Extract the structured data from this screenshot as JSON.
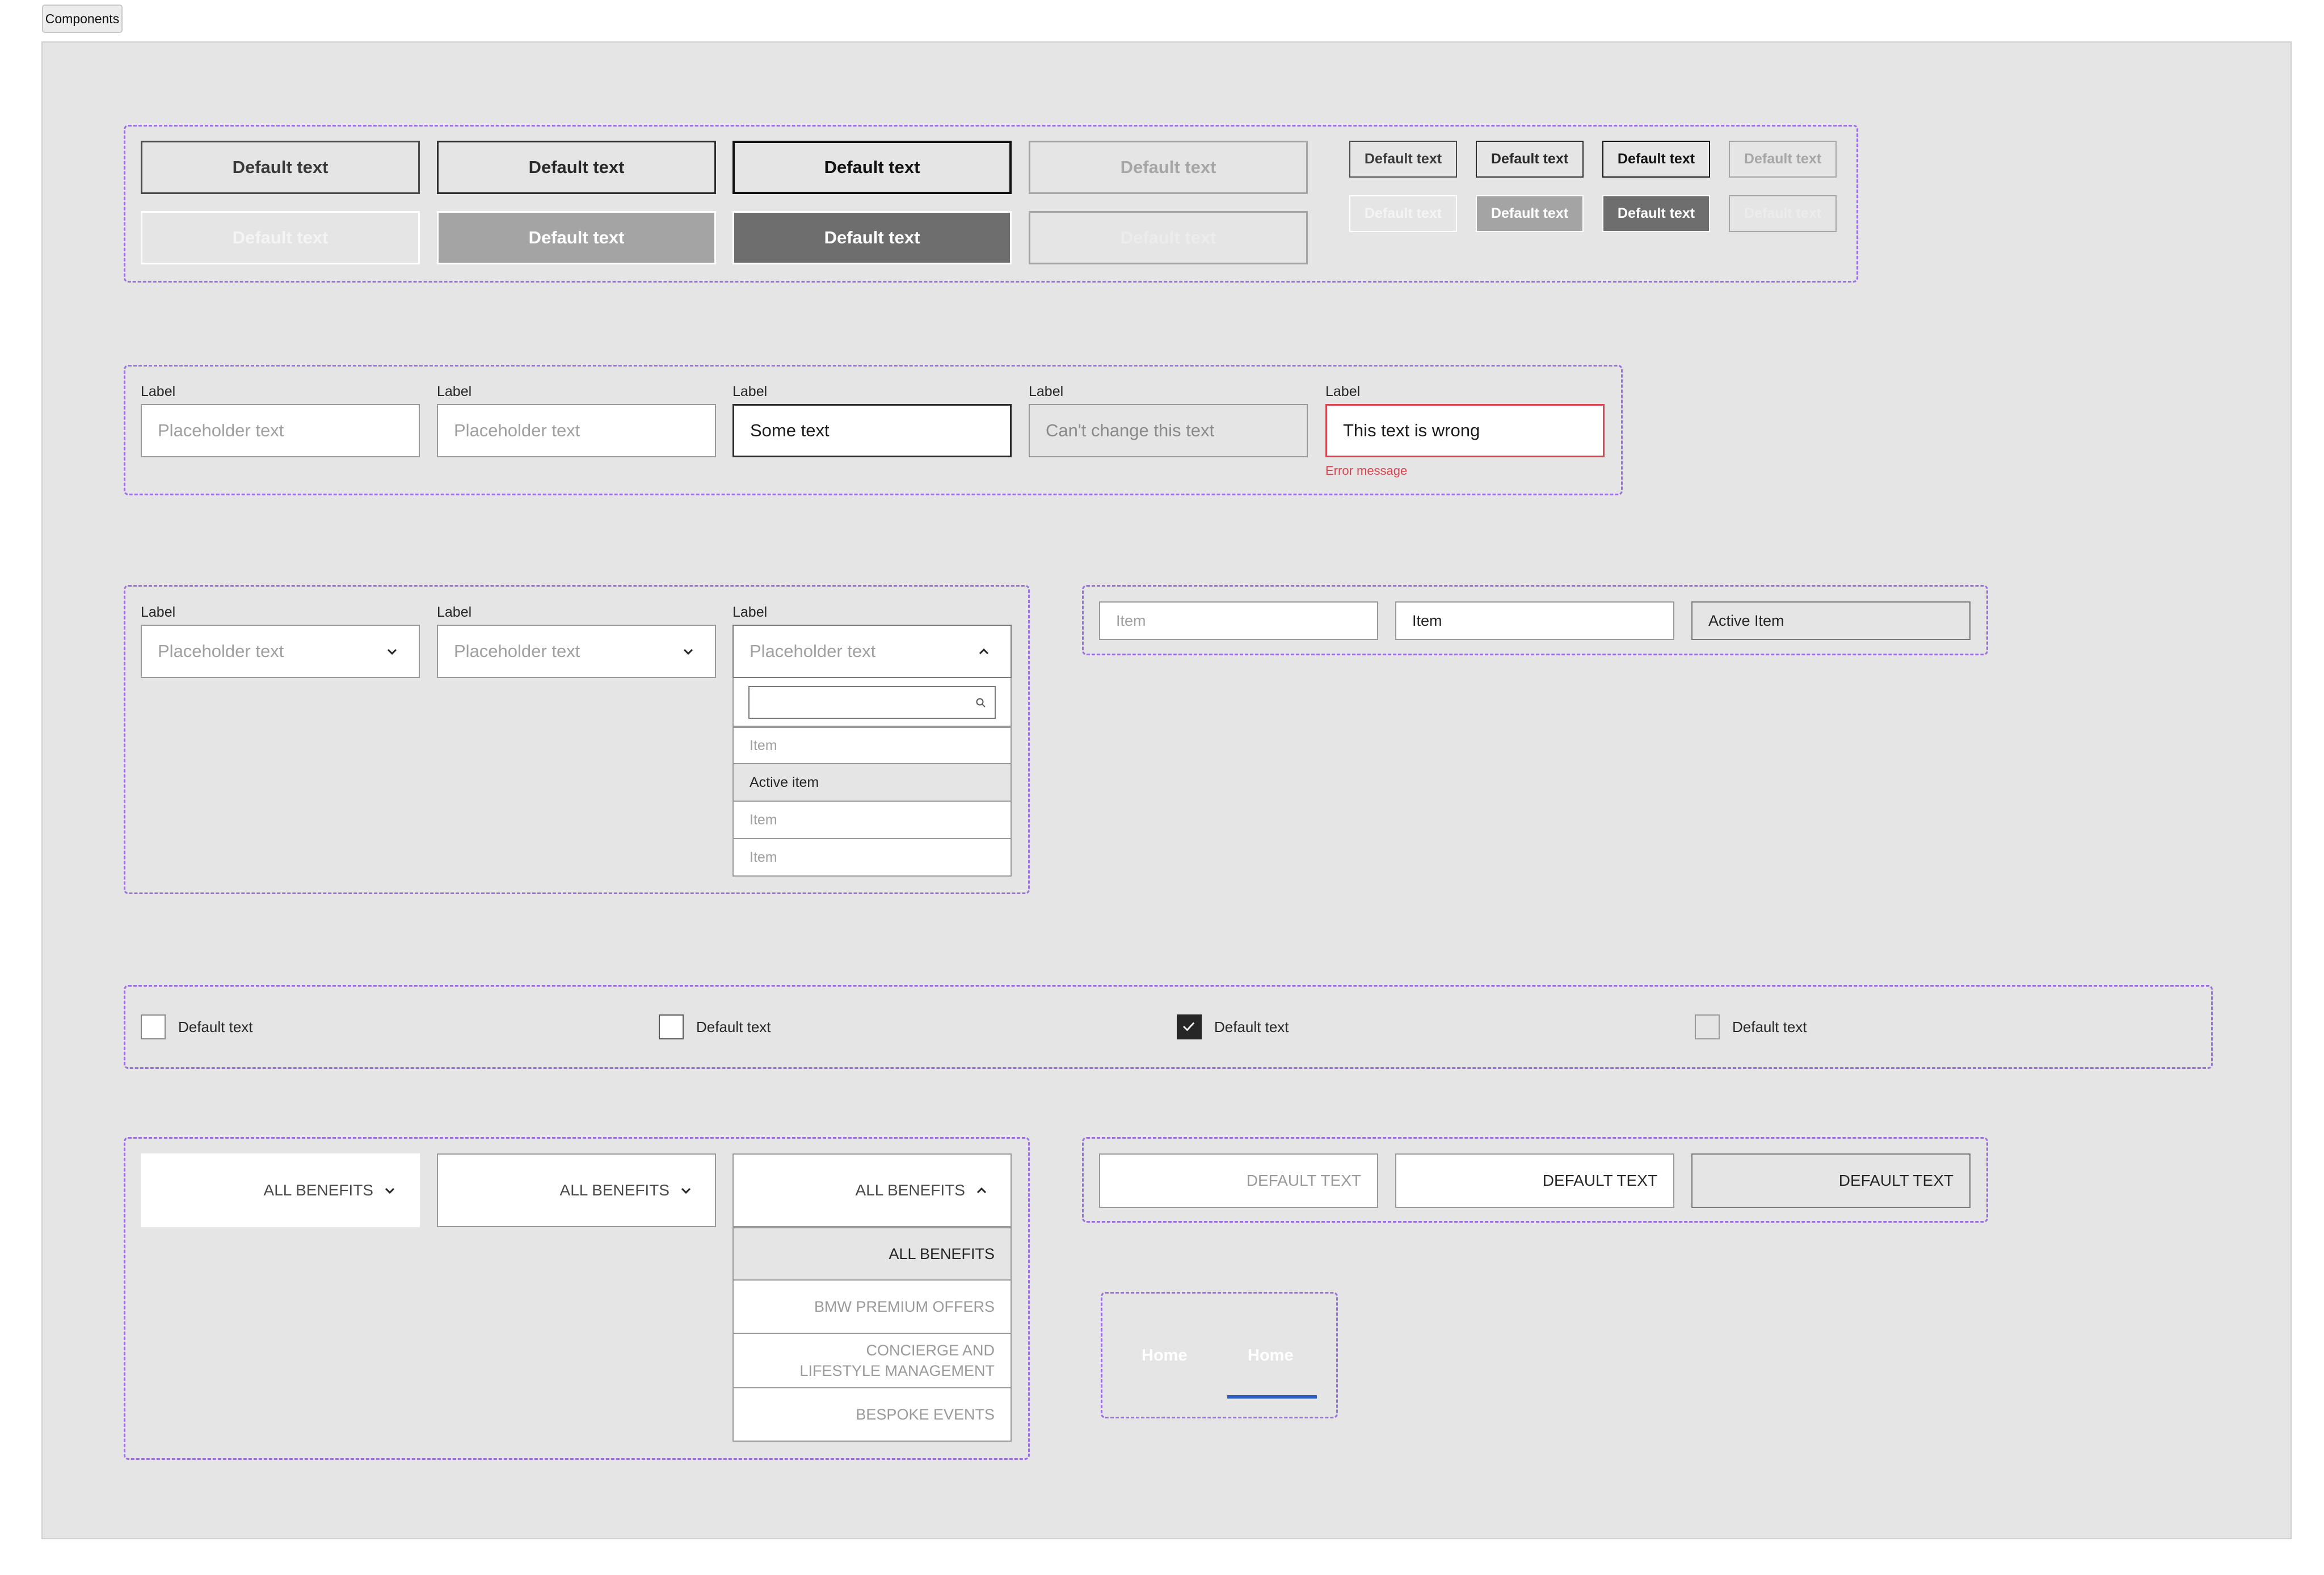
{
  "toolbar": {
    "tag_label": "Components"
  },
  "buttons": {
    "large": {
      "row1": [
        "Default text",
        "Default text",
        "Default text",
        "Default text"
      ],
      "row2": [
        "Default text",
        "Default text",
        "Default text",
        "Default text"
      ]
    },
    "small": {
      "row1": [
        "Default text",
        "Default text",
        "Default text",
        "Default text"
      ],
      "row2": [
        "Default text",
        "Default text",
        "Default text",
        "Default text"
      ]
    }
  },
  "inputs": [
    {
      "label": "Label",
      "text": "Placeholder text",
      "state": "empty"
    },
    {
      "label": "Label",
      "text": "Placeholder text",
      "state": "focus-empty"
    },
    {
      "label": "Label",
      "text": "Some text",
      "state": "filled"
    },
    {
      "label": "Label",
      "text": "Can't change this text",
      "state": "readonly"
    },
    {
      "label": "Label",
      "text": "This text is wrong",
      "state": "error",
      "error": "Error message"
    }
  ],
  "dropdowns": [
    {
      "label": "Label",
      "placeholder": "Placeholder text"
    },
    {
      "label": "Label",
      "placeholder": "Placeholder text"
    },
    {
      "label": "Label",
      "placeholder": "Placeholder text",
      "search_value": "",
      "options": [
        "Item",
        "Active item",
        "Item",
        "Item"
      ]
    }
  ],
  "segments": [
    "Item",
    "Item",
    "Active Item"
  ],
  "checkboxes": [
    "Default text",
    "Default text",
    "Default text",
    "Default text"
  ],
  "filters": {
    "label": "ALL BENEFITS",
    "options": [
      "ALL BENEFITS",
      "BMW PREMIUM OFFERS",
      "CONCIERGE AND LIFESTYLE MANAGEMENT",
      "BESPOKE EVENTS"
    ]
  },
  "upper_buttons": [
    "DEFAULT TEXT",
    "DEFAULT TEXT",
    "DEFAULT TEXT"
  ],
  "nav": [
    "Home",
    "Home"
  ],
  "colors": {
    "frame": "#9b71e0",
    "error": "#d9454f",
    "nav_underline": "#2d5fc4"
  }
}
